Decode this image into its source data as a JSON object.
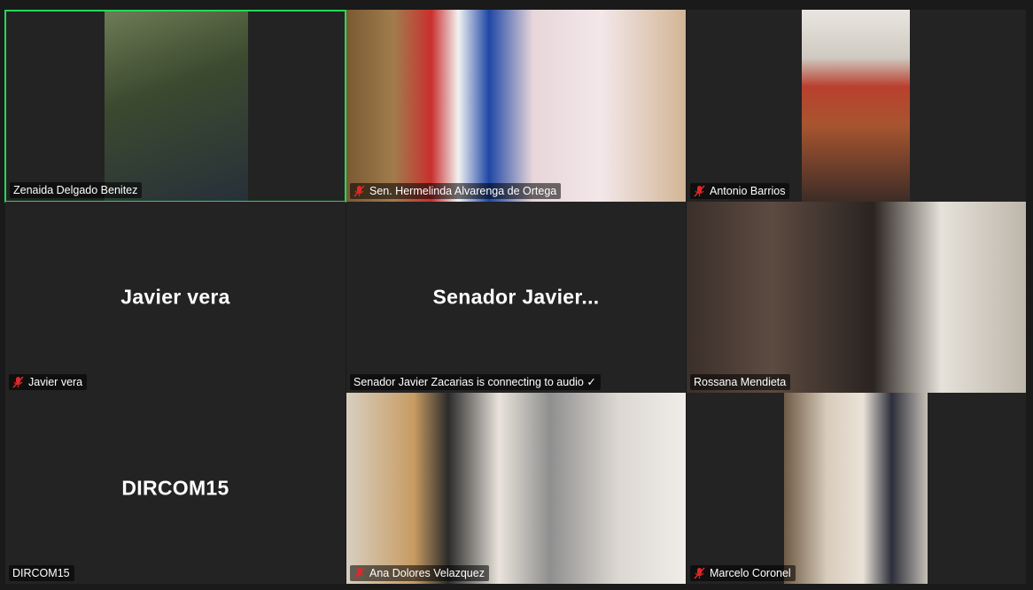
{
  "participants": [
    {
      "name": "Zenaida Delgado Benitez",
      "muted": false,
      "active_speaker": true,
      "video": true
    },
    {
      "name": "Sen. Hermelinda Alvarenga de Ortega",
      "muted": true,
      "active_speaker": false,
      "video": true
    },
    {
      "name": "Antonio Barrios",
      "muted": true,
      "active_speaker": false,
      "video": true
    },
    {
      "name": "Javier vera",
      "display_name": "Javier vera",
      "muted": true,
      "active_speaker": false,
      "video": false
    },
    {
      "name": "Senador Javier Zacarias is connecting to audio ✓",
      "display_name": "Senador  Javier...",
      "muted": false,
      "active_speaker": false,
      "video": false
    },
    {
      "name": "Rossana Mendieta",
      "muted": false,
      "active_speaker": false,
      "video": true
    },
    {
      "name": "DIRCOM15",
      "display_name": "DIRCOM15",
      "muted": false,
      "active_speaker": false,
      "video": false
    },
    {
      "name": "Ana Dolores Velazquez",
      "muted": true,
      "active_speaker": false,
      "video": true
    },
    {
      "name": "Marcelo Coronel",
      "muted": true,
      "active_speaker": false,
      "video": true
    }
  ],
  "colors": {
    "active_border": "#23d959",
    "tile_background": "#232323",
    "muted_icon": "#e02828"
  },
  "icons": {
    "muted": "mic-muted-icon"
  }
}
